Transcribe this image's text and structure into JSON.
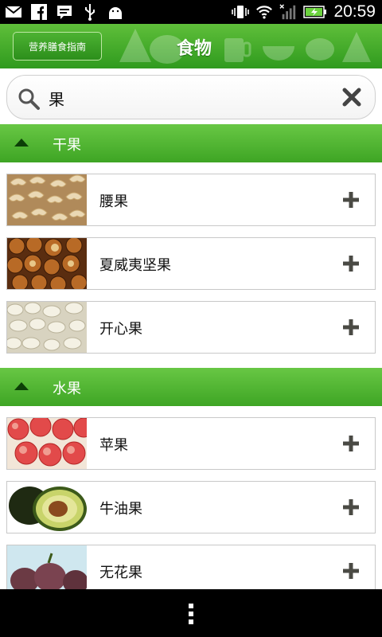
{
  "status_bar": {
    "time": "20:59",
    "left_icons": [
      "mail-icon",
      "facebook-icon",
      "message-icon",
      "usb-icon",
      "android-icon"
    ],
    "right_icons": [
      "vibrate-icon",
      "wifi-icon",
      "signal-icon",
      "battery-icon"
    ]
  },
  "header": {
    "guide_button": "营养膳食指南",
    "title": "食物"
  },
  "search": {
    "query": "果"
  },
  "sections": [
    {
      "label": "干果",
      "items": [
        {
          "label": "腰果",
          "thumb": "cashew-image"
        },
        {
          "label": "夏威夷坚果",
          "thumb": "macadamia-image"
        },
        {
          "label": "开心果",
          "thumb": "pistachio-image"
        }
      ]
    },
    {
      "label": "水果",
      "items": [
        {
          "label": "苹果",
          "thumb": "apple-image"
        },
        {
          "label": "牛油果",
          "thumb": "avocado-image"
        },
        {
          "label": "无花果",
          "thumb": "fig-image"
        }
      ]
    }
  ],
  "colors": {
    "header_green": "#3ea524",
    "section_green": "#55b936",
    "plus": "#4a4a44"
  }
}
